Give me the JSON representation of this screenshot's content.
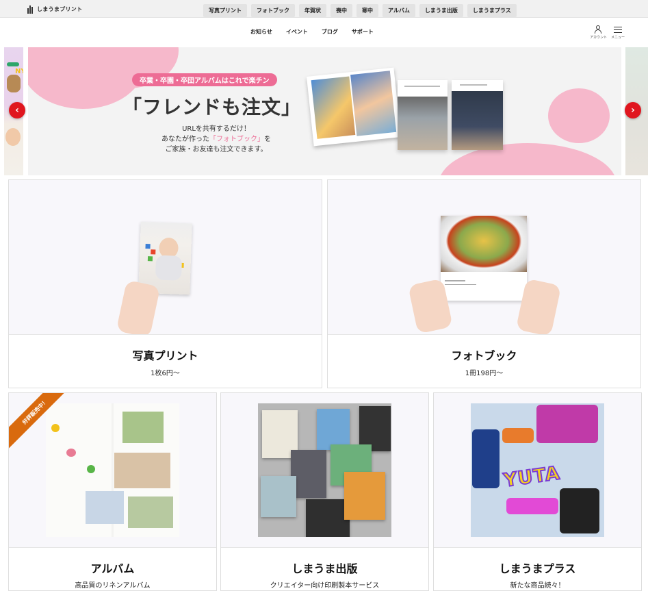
{
  "header": {
    "logo_text": "しまうまプリント",
    "service_tabs": [
      "写真プリント",
      "フォトブック",
      "年賀状",
      "喪中",
      "寒中",
      "アルバム",
      "しまうま出版",
      "しまうまプラス"
    ]
  },
  "subnav": {
    "items": [
      "お知らせ",
      "イベント",
      "ブログ",
      "サポート"
    ],
    "account_label": "アカウント",
    "menu_label": "メニュー"
  },
  "banner": {
    "tag": "卒業・卒園・卒団アルバムはこれで楽チン",
    "headline": "「フレンドも注文」",
    "copy_line1": "URLを共有するだけ！",
    "copy_line2_prefix": "あなたが作った",
    "copy_line2_highlight": "「フォトブック」",
    "copy_line2_suffix": "を",
    "copy_line3": "ご家族・お友達も注文できます。",
    "prev_arrow": "‹",
    "next_arrow": "›",
    "accent_color": "#ed6c95",
    "arrow_color": "#e0161f"
  },
  "products": [
    {
      "title": "写真プリント",
      "sub": "1枚6円〜"
    },
    {
      "title": "フォトブック",
      "sub": "1冊198円〜"
    },
    {
      "title": "アルバム",
      "sub": "高品質のリネンアルバム",
      "ribbon": "好評販売中！"
    },
    {
      "title": "しまうま出版",
      "sub": "クリエイター向け印刷製本サービス"
    },
    {
      "title": "しまうまプラス",
      "sub": "新たな商品続々！",
      "sticker_text": "YUTA"
    }
  ]
}
